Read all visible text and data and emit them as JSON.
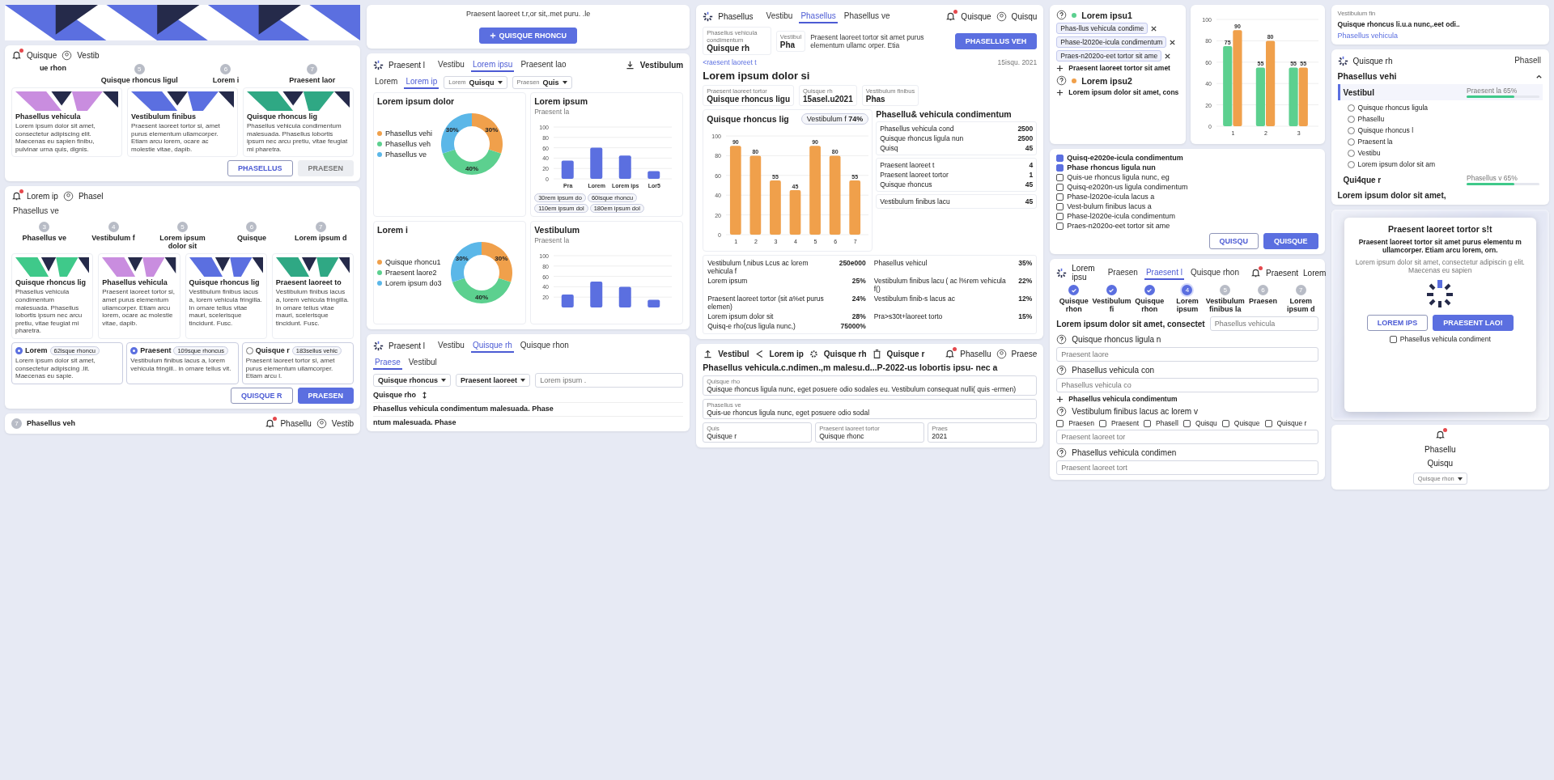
{
  "cards_top": {
    "header": {
      "notifications": true,
      "menu": "Quisque",
      "user": "Vestib"
    },
    "steps": [
      {
        "label": "ue rhon"
      },
      {
        "number": "5",
        "label": "Quisque rhoncus ligul"
      },
      {
        "number": "6",
        "label": "Lorem i"
      },
      {
        "number": "7",
        "label": "Praesent laor"
      }
    ],
    "cards": [
      {
        "title": "Phasellus vehicula",
        "text": "Lorem ipsum dolor sit amet, consectetur adipiscing elit. Maecenas eu sapien finibu, pulvinar urna quis, dignis.",
        "color": "#c98ddf"
      },
      {
        "title": "Vestibulum finibus",
        "text": "Praesent laoreet tortor si, amet purus elementum ullamcorper. Etiam arcu lorem, ocare ac molestie vitae, dapib.",
        "color": "#5b6fe0"
      },
      {
        "title": "Quisque rhoncus lig",
        "text": "Phasellus vehicula condimentum malesuada. Phasellus lobortis ipsum nec arcu pretiu, vitae feugiat mi pharetra.",
        "color": "#2fa884"
      }
    ],
    "buttons": [
      {
        "label": "PHASELLUS",
        "kind": "outline",
        "disabled": false
      },
      {
        "label": "PRAESEN",
        "kind": "primary",
        "disabled": true
      }
    ]
  },
  "cards_bottom": {
    "header": {
      "notifications": true,
      "menu": "Lorem ip",
      "user": "Phasel"
    },
    "tab": "Phasellus ve",
    "steps": [
      {
        "number": "3",
        "label": "Phasellus ve"
      },
      {
        "number": "4",
        "label": "Vestibulum f"
      },
      {
        "number": "5",
        "label": "Lorem ipsum dolor sit"
      },
      {
        "number": "6",
        "label": "Quisque"
      },
      {
        "number": "7",
        "label": "Lorem ipsum d"
      }
    ],
    "cards": [
      {
        "title": "Quisque rhoncus lig",
        "text": "Phasellus vehicula condimentum malesuada. Phasellus lobortis ipsum nec arcu pretiu, vitae feugiat mi pharetra.",
        "color": "#3fc98a"
      },
      {
        "title": "Phasellus vehicula",
        "text": "Praesent laoreet tortor si, amet purus elementum ullamcorper. Etiam arcu lorem, ocare ac molestie vitae, dapib.",
        "color": "#c98ddf"
      },
      {
        "title": "Quisque rhoncus lig",
        "text": "Vestibulum finibus lacus a, lorem vehicula fringilla. In ornare tellus vitae mauri, scelerisque tincidunt. Fusc.",
        "color": "#5b6fe0"
      },
      {
        "title": "Praesent laoreet to",
        "text": "Vestibulum finibus lacus a, lorem vehicula fringilla. In ornare tellus vitae mauri, scelerisque tincidunt. Fusc.",
        "color": "#2fa884"
      }
    ],
    "options": [
      {
        "title": "Lorem",
        "tag": "62isque rhoncu",
        "text": "Lorem ipsum dolor sit amet, consectetur adipiscing .lit. Maecenas eu sapie.",
        "selected": true
      },
      {
        "title": "Praesent",
        "tag": "109sque rhoncus",
        "text": "Vestibulum finibus lacus a, lorem vehicula fringill.. in ornare tellus vit.",
        "selected": true
      },
      {
        "title": "Quisque r",
        "tag": "183sellus vehic",
        "text": "Praesent laoreet tortor si, amet purus elementum ullamcorper. Etiam arcu l.",
        "selected": false
      }
    ],
    "buttons": [
      {
        "label": "QUISQUE R",
        "kind": "outline",
        "disabled": false
      },
      {
        "label": "PRAESEN",
        "kind": "primary",
        "disabled": false
      }
    ],
    "footer": {
      "notifications": true,
      "menu": "Phasellu",
      "user": "Vestib",
      "step_number": "7",
      "step_label": "Phasellus veh"
    }
  },
  "dashboard": {
    "top_strip": {
      "text": "Praesent laoreet t.r,or sit,.met puru. .le",
      "button": "QUISQUE RHONCU"
    },
    "brand": "Praesent l",
    "tabs": [
      {
        "label": "Vestibu",
        "selected": false
      },
      {
        "label": "Lorem ipsu",
        "selected": true
      },
      {
        "label": "Praesent lao",
        "selected": false
      }
    ],
    "action": "Vestibulum",
    "subtabs": [
      {
        "label": "Lorem",
        "selected": false
      },
      {
        "label": "Lorem ip",
        "selected": true
      }
    ],
    "selects": [
      {
        "label": "Lorem",
        "value": "Quisqu"
      },
      {
        "label": "Praesen",
        "value": "Quis"
      }
    ],
    "donuts": [
      {
        "title": "Lorem ipsum dolor",
        "legend": [
          {
            "label": "Phasellus vehi",
            "color": "#f0a04b"
          },
          {
            "label": "Phasellus veh",
            "color": "#5cd08f"
          },
          {
            "label": "Phasellus ve",
            "color": "#5bb7e8"
          }
        ],
        "chart_data": {
          "type": "donut",
          "values": [
            30,
            40,
            30
          ],
          "value_labels": [
            "30%",
            "40%",
            "30%"
          ]
        }
      },
      {
        "title": "Lorem i",
        "legend": [
          {
            "label": "Quisque rhoncu1",
            "color": "#f0a04b"
          },
          {
            "label": "Praesent laore2",
            "color": "#5cd08f"
          },
          {
            "label": "Lorem ipsum do3",
            "color": "#5bb7e8"
          }
        ],
        "chart_data": {
          "type": "donut",
          "values": [
            30,
            40,
            30
          ],
          "value_labels": [
            "30%",
            "40%",
            "30%"
          ]
        }
      }
    ],
    "bar_charts": [
      {
        "title": "Lorem ipsum",
        "subtitle": "Praesent la",
        "notes": [
          "30rem ipsum do",
          "60isque rhoncu",
          "110em ipsum dol",
          "180em ipsum dol"
        ],
        "chart_data": {
          "type": "bar",
          "categories": [
            "Pra",
            "Lorem",
            "Lorem ips",
            "Lor5"
          ],
          "values": [
            35,
            60,
            45,
            15
          ],
          "yticks": [
            0,
            20,
            40,
            60,
            80,
            100
          ],
          "ylim": [
            0,
            100
          ],
          "grid": true
        }
      },
      {
        "title": "Vestibulum",
        "subtitle": "Praesent la",
        "chart_data": {
          "type": "bar",
          "values": [
            25,
            50,
            40,
            15
          ],
          "yticks": [
            20,
            40,
            60,
            80,
            100
          ],
          "ylim": [
            0,
            100
          ],
          "grid": true
        }
      }
    ]
  },
  "list_screen": {
    "brand": "Praesent l",
    "tabs": [
      {
        "label": "Vestibu",
        "selected": false
      },
      {
        "label": "Quisque rh",
        "selected": true
      },
      {
        "label": "Quisque rhon",
        "selected": false
      }
    ],
    "subtabs": [
      {
        "label": "Praese",
        "selected": true
      },
      {
        "label": "Vestibul",
        "selected": false
      }
    ],
    "selects": [
      "Quisque rhoncus",
      "Praesent laoreet"
    ],
    "search_placeholder": "Lorem ipsum .",
    "column": "Quisque rho",
    "rows": [
      "Phasellus vehicula condimentum malesuada. Phase",
      "ntum malesuada. Phase"
    ],
    "header": {
      "notifications": true,
      "menu": "Phasellu",
      "user": "Praese"
    },
    "toolbar": [
      {
        "label": "Vestibul",
        "kind": "upload"
      },
      {
        "label": "Lorem ip",
        "kind": "share"
      },
      {
        "label": "Quisque rh",
        "kind": "gear"
      },
      {
        "label": "Quisque r",
        "kind": "trash"
      }
    ],
    "title": "Phasellus vehicula.c.ndimen.,m malesu.d...P-2022-us lobortis ipsu- nec a",
    "fields": [
      {
        "label": "Quisque rho",
        "value": "Quisque rhoncus ligula nunc, eget posuere odio sodales eu. Vestibulum consequat nulli( quis -ermen)"
      },
      {
        "label": "Phasellus ve",
        "value": "Quis-ue rhoncus ligula nunc, eget posuere odio sodal"
      },
      {
        "label": "Quis",
        "value": "Quisque r"
      },
      {
        "label": "Praesent laoreet tortor",
        "value": "Quisque rhonc"
      },
      {
        "label": "Praes",
        "value": "2021"
      }
    ]
  },
  "detail": {
    "header": {
      "notifications": true,
      "menu": "Quisque",
      "user": "Quisqu"
    },
    "brand": "Phasellus",
    "tabs": [
      {
        "label": "Vestibu",
        "selected": false
      },
      {
        "label": "Phasellus",
        "selected": true
      },
      {
        "label": "Phasellus ve",
        "selected": false
      }
    ],
    "head_info": [
      {
        "label": "Phasellus vehicula condimentum",
        "value": "Quisque rh"
      },
      {
        "label": "Vestibul",
        "value": "Pha"
      }
    ],
    "note": "Praesent laoreet tortor sit amet purus elementum ullamc orper. Etia",
    "button": "PHASELLUS VEH",
    "date": "15isqu. 2021",
    "breadcrumb": "<raesent laoreet t",
    "title": "Lorem ipsum dolor si",
    "info": [
      {
        "label": "Praesent laoreet tortor",
        "value": "Quisque rhoncus ligu"
      },
      {
        "label": "Quisque rh",
        "value": "15asel.u2021"
      },
      {
        "label": "Vestibulum finibus",
        "value": "Phas"
      }
    ],
    "chart_title": "Quisque rhoncus lig",
    "chart_badge": {
      "label": "Vestibulum f",
      "value": "74%"
    },
    "chart_data": {
      "type": "bar",
      "categories": [
        "1",
        "2",
        "3",
        "4",
        "5",
        "6",
        "7"
      ],
      "values": [
        90,
        80,
        55,
        45,
        90,
        80,
        55
      ],
      "yticks": [
        0,
        20,
        40,
        60,
        80,
        100
      ],
      "ylim": [
        0,
        100
      ],
      "grid": true,
      "data_labels": true
    },
    "list_title": "Phasellu& vehicula condimentum",
    "groups": [
      [
        {
          "label": "Phasellus vehicula cond",
          "value": "2500"
        },
        {
          "label": "Quisque rhoncus ligula nun",
          "value": "2500"
        },
        {
          "label": "Quisq",
          "value": "45"
        }
      ],
      [
        {
          "label": "Praesent laoreet t",
          "value": "4"
        },
        {
          "label": "Praesent laoreet tortor",
          "value": "1"
        },
        {
          "label": "Quisque rhoncus",
          "value": "45"
        }
      ],
      [
        {
          "label": "Vestibulum finibus lacu",
          "value": "45"
        }
      ]
    ],
    "table": [
      {
        "label": "Vestibulum f,nibus Lcus ac lorem vehicula f",
        "value": "250e000"
      },
      {
        "label": "Phasellus vehicul",
        "value": "35%"
      },
      {
        "label": "Lorem ipsum",
        "value": "25%"
      },
      {
        "label": "Vestibulum finibus lacu ( ac l%rem vehicula f()",
        "value": "22%"
      },
      {
        "label": "Praesent laoreet tortor (sit a%et purus elemen)",
        "value": "24%"
      },
      {
        "label": "Vestibulum finib-s lacus ac",
        "value": "12%"
      },
      {
        "label": "Lorem ipsum dolor sit",
        "value": "28%"
      },
      {
        "label": "Pra>s30t+laoreet torto",
        "value": "15%"
      },
      {
        "label": "Quisq-e rho(cus ligula nunc,)",
        "value": "75000%"
      }
    ]
  },
  "tag_groups": [
    {
      "title": "Lorem ipsu1",
      "color": "#5cd08f",
      "tags": [
        "Phas-llus vehicula condime",
        "Phase-l2020e-icula condimentum",
        "Praes-n2020o-eet tortor sit ame"
      ],
      "add": "Praesent laoreet tortor sit amet"
    },
    {
      "title": "Lorem ipsu2",
      "color": "#f0a04b",
      "add": "Lorem ipsum dolor sit amet, cons"
    }
  ],
  "grouped_chart": {
    "chart_data": {
      "type": "bar",
      "categories": [
        "1",
        "2",
        "3"
      ],
      "series": [
        {
          "color": "#5cd08f",
          "values": [
            75,
            55,
            55
          ]
        },
        {
          "color": "#f0a04b",
          "values": [
            90,
            80,
            55
          ]
        }
      ],
      "yticks": [
        0,
        20,
        40,
        60,
        80,
        100
      ],
      "ylim": [
        0,
        100
      ],
      "grid": true,
      "data_labels": true
    }
  },
  "checklist": {
    "items": [
      {
        "label": "Quisq-e2020e-icula condimentum",
        "checked": true
      },
      {
        "label": "Phase rhoncus ligula nun",
        "checked": true
      },
      {
        "label": "Quis-ue rhoncus ligula nunc, eg",
        "checked": false
      },
      {
        "label": "Quisq-e2020n-us ligula condimentum",
        "checked": false
      },
      {
        "label": "Phase-l2020e-icula lacus a",
        "checked": false
      },
      {
        "label": "Vest-bulum finibus lacus a",
        "checked": false
      },
      {
        "label": "Phase-l2020e-icula condimentum",
        "checked": false
      },
      {
        "label": "Praes-n2020o-eet tortor sit ame",
        "checked": false
      }
    ],
    "buttons": [
      {
        "label": "QUISQU",
        "kind": "outline",
        "disabled": false
      },
      {
        "label": "QUISQUE",
        "kind": "primary",
        "disabled": false
      }
    ]
  },
  "wizard": {
    "header": {
      "notifications": true,
      "menu": "Praesent",
      "user": "Lorem"
    },
    "brand": "Lorem ipsu",
    "tabs": [
      {
        "label": "Praesen",
        "selected": false
      },
      {
        "label": "Praesent l",
        "selected": true
      },
      {
        "label": "Quisque rhon",
        "selected": false
      }
    ],
    "steps": [
      {
        "completed": true,
        "active": false,
        "label": "Quisque rhon"
      },
      {
        "completed": true,
        "active": false,
        "label": "Vestibulum fi"
      },
      {
        "completed": true,
        "active": false,
        "label": "Quisque rhon"
      },
      {
        "completed": false,
        "active": true,
        "number": "4",
        "label": "Lorem ipsum"
      },
      {
        "completed": false,
        "active": false,
        "number": "5",
        "label": "Vestibulum finibus la"
      },
      {
        "completed": false,
        "active": false,
        "number": "6",
        "label": "Praesen"
      },
      {
        "completed": false,
        "active": false,
        "number": "7",
        "label": "Lorem ipsum d"
      }
    ],
    "heading": "Lorem ipsum dolor sit amet, consectet",
    "side_placeholder": "Phasellus vehicula",
    "questions": [
      {
        "label": "Quisque rhoncus ligula n",
        "kind": "text",
        "placeholder": "Praesent laore"
      },
      {
        "label": "Phasellus vehicula con",
        "kind": "text",
        "placeholder": "Phasellus vehicula co",
        "add": "Phasellus vehicula condimentum"
      },
      {
        "label": "Vestibulum finibus lacus ac lorem v",
        "kind": "checks",
        "options": [
          {
            "label": "Praesen",
            "checked": false
          },
          {
            "label": "Praesent",
            "checked": false
          },
          {
            "label": "Phasell",
            "checked": false
          },
          {
            "label": "Quisqu",
            "checked": false
          },
          {
            "label": "Quisque",
            "checked": false
          },
          {
            "label": "Quisque r",
            "checked": false
          }
        ],
        "placeholder": "Praesent laoreet tor"
      },
      {
        "label": "Phasellus vehicula condimen",
        "kind": "text",
        "placeholder": "Praesent laoreet tort"
      }
    ]
  },
  "sidebar": {
    "top_label": "Vestibulum fin",
    "top_value": "Quisque rhoncus li.u.a nunc,.eet odi..",
    "link": "Phasellus vehicula",
    "tab": "Phasell",
    "brand": "Quisque rh",
    "title": "Phasellus vehi",
    "expanded": true,
    "items": [
      {
        "label": "Vestibul",
        "selected": true,
        "progress_label": "Praesent la",
        "progress_value": "65%",
        "level": 0.65,
        "children": [
          {
            "label": "Quisque rhoncus ligula",
            "selected": false
          },
          {
            "label": "Phasellu",
            "selected": false
          },
          {
            "label": "Quisque rhoncus l",
            "selected": false
          },
          {
            "label": "Praesent la",
            "selected": false
          },
          {
            "label": "Vestibu",
            "selected": false
          },
          {
            "label": "Lorem ipsum dolor sit am",
            "selected": false
          }
        ]
      },
      {
        "label": "Qui4que r",
        "selected": false,
        "progress_label": "Phasellus v",
        "progress_value": "65%",
        "level": 0.65
      }
    ],
    "footer": "Lorem ipsum dolor sit amet,"
  },
  "modal": {
    "title": "Praesent laoreet tortor s!t",
    "lead": "Praesent laoreet tortor sit amet purus elementu m ullamcorper. Etiam arcu lorem, orn.",
    "text": "Lorem ipsum dolor sit amet, consectetur adipiscin g elit. Maecenas eu sapien",
    "buttons": [
      {
        "label": "LOREM IPS",
        "kind": "outline",
        "disabled": false
      },
      {
        "label": "PRAESENT LAO!",
        "kind": "primary",
        "disabled": false
      }
    ],
    "checkbox": {
      "label": "Phasellus vehicula condiment",
      "checked": false
    },
    "footer": {
      "notifications": true,
      "menu": "Phasellu",
      "user": "Quisqu",
      "select": "Quisque rhon"
    }
  }
}
